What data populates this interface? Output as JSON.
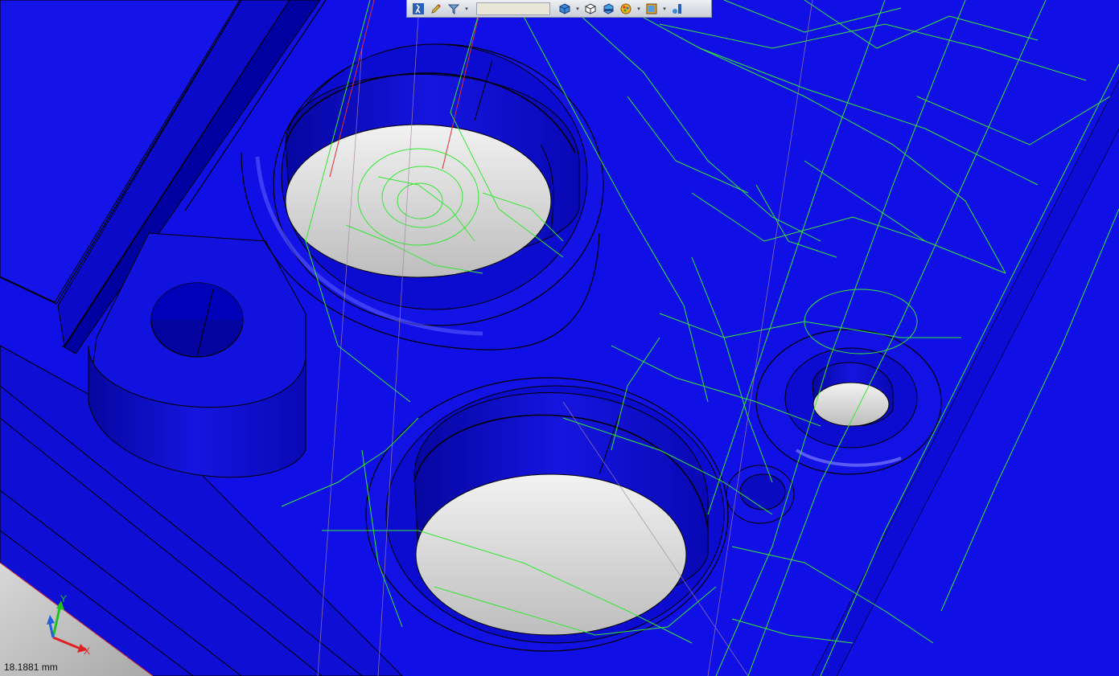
{
  "viewport": {
    "scale_text": "18.1881 mm",
    "triad": {
      "y_label": "Y",
      "x_label": "X"
    }
  },
  "toolbar": {
    "buttons": [
      {
        "name": "walkthrough-icon",
        "dropdown": false
      },
      {
        "name": "edit-pencil-icon",
        "dropdown": false
      },
      {
        "name": "filter-icon",
        "dropdown": true
      },
      {
        "name": "field",
        "dropdown": false
      },
      {
        "name": "shaded-cube-icon",
        "dropdown": true
      },
      {
        "name": "wireframe-cube-icon",
        "dropdown": false
      },
      {
        "name": "section-view-icon",
        "dropdown": false
      },
      {
        "name": "appearance-icon",
        "dropdown": true
      },
      {
        "name": "scene-icon",
        "dropdown": true
      },
      {
        "name": "display-settings-icon",
        "dropdown": false
      }
    ]
  },
  "colors": {
    "part": "#1010e6",
    "part_dark": "#0707b0",
    "part_light": "#2f2ff2",
    "hole_floor": "#d9d9d9",
    "edge": "#000000",
    "toolpath": "#33e833",
    "red_line": "#e03030"
  }
}
